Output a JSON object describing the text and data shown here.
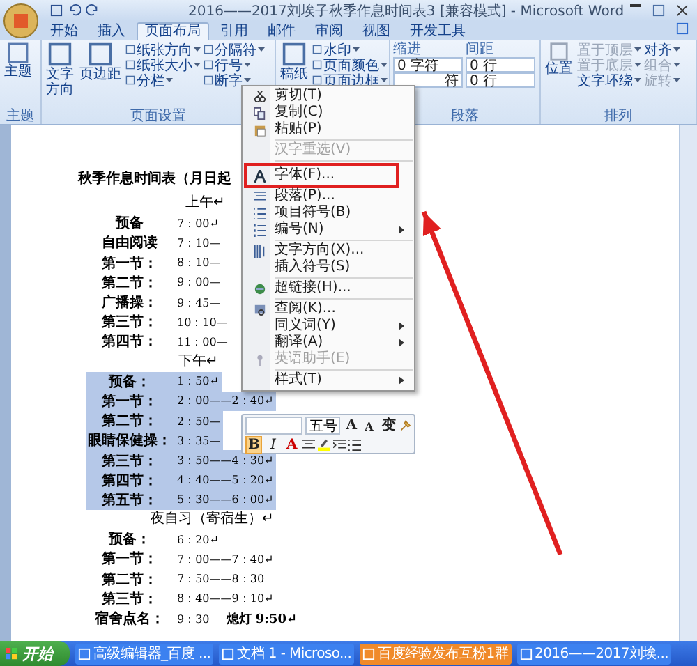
{
  "window": {
    "title": "2016——2017刘埃子秋季作息时间表3 [兼容模式] - Microsoft Word"
  },
  "tabs": [
    {
      "label": "开始",
      "selected": false
    },
    {
      "label": "插入",
      "selected": false
    },
    {
      "label": "页面布局",
      "selected": true
    },
    {
      "label": "引用",
      "selected": false
    },
    {
      "label": "邮件",
      "selected": false
    },
    {
      "label": "审阅",
      "selected": false
    },
    {
      "label": "视图",
      "selected": false
    },
    {
      "label": "开发工具",
      "selected": false
    }
  ],
  "ribbon": {
    "theme": {
      "label": "主题",
      "button": "主题"
    },
    "page_setup": {
      "label": "页面设置",
      "large": [
        "文字方向",
        "页边距"
      ],
      "small": [
        "纸张方向",
        "纸张大小",
        "分栏",
        "分隔符",
        "行号",
        "断字"
      ]
    },
    "background": {
      "large": "稿纸",
      "small": [
        "水印",
        "页面颜色",
        "页面边框"
      ]
    },
    "paragraph": {
      "label": "段落",
      "indent_label": "缩进",
      "indent": [
        "0 字符",
        "符"
      ],
      "spacing_label": "间距",
      "spacing": [
        "0 行",
        "0 行"
      ]
    },
    "arrange": {
      "label": "排列",
      "large": "位置",
      "small": [
        {
          "label": "置于顶层",
          "disabled": true
        },
        {
          "label": "置于底层",
          "disabled": true
        },
        {
          "label": "文字环绕",
          "disabled": false
        },
        {
          "label": "对齐",
          "disabled": false
        },
        {
          "label": "组合",
          "disabled": true
        },
        {
          "label": "旋转",
          "disabled": true
        }
      ]
    }
  },
  "document": {
    "title": "秋季作息时间表（月日起",
    "lines": [
      {
        "kind": "heading",
        "text": "上午↵"
      },
      {
        "kind": "entry",
        "label": "预备",
        "time": "7：00↵",
        "selected": false
      },
      {
        "kind": "entry",
        "label": "自由阅读",
        "time": "7：10—",
        "selected": false
      },
      {
        "kind": "entry",
        "label": "第一节：",
        "time": "8：10—",
        "selected": false
      },
      {
        "kind": "entry",
        "label": "第二节：",
        "time": "9：00—",
        "selected": false
      },
      {
        "kind": "entry",
        "label": "广播操：",
        "time": "9：45—",
        "selected": false
      },
      {
        "kind": "entry",
        "label": "第三节：",
        "time": "10：10—",
        "selected": false
      },
      {
        "kind": "entry",
        "label": "第四节：",
        "time": "11：00—",
        "selected": false
      },
      {
        "kind": "heading",
        "text": "下午↵"
      },
      {
        "kind": "entry",
        "label": "预备：",
        "time": "1：50↵",
        "selected": true
      },
      {
        "kind": "entry",
        "label": "第一节：",
        "time": "2：00——2：40↵",
        "selected": true
      },
      {
        "kind": "entry",
        "label": "第二节：",
        "time": "2：50—",
        "selected": true
      },
      {
        "kind": "entry",
        "label": "眼睛保健操：",
        "time": "3：35—",
        "selected": true
      },
      {
        "kind": "entry",
        "label": "第三节：",
        "time": "3：50——4：30↵",
        "selected": true
      },
      {
        "kind": "entry",
        "label": "第四节：",
        "time": "4：40——5：20↵",
        "selected": true
      },
      {
        "kind": "entry",
        "label": "第五节：",
        "time": "5：30——6：00↵",
        "selected": true
      },
      {
        "kind": "heading",
        "text": "夜自习（寄宿生）↵"
      },
      {
        "kind": "entry",
        "label": "预备：",
        "time": "6：20↵",
        "selected": false
      },
      {
        "kind": "entry",
        "label": "第一节：",
        "time": "7：00——7：40↵",
        "selected": false
      },
      {
        "kind": "entry",
        "label": "第二节：",
        "time": "7：50——8：30",
        "selected": false
      },
      {
        "kind": "entry",
        "label": "第三节：",
        "time": "8：40——9：10↵",
        "selected": false
      },
      {
        "kind": "entry",
        "label": "宿舍点名：",
        "time": "9：30",
        "note": "熄灯 9:50↵",
        "selected": false
      }
    ]
  },
  "context_menu": {
    "sections": [
      [
        {
          "label": "剪切(T)",
          "disabled": false,
          "submenu": false
        },
        {
          "label": "复制(C)",
          "disabled": false,
          "submenu": false
        },
        {
          "label": "粘贴(P)",
          "disabled": false,
          "submenu": false
        }
      ],
      [
        {
          "label": "汉字重选(V)",
          "disabled": true,
          "submenu": false
        }
      ],
      [
        {
          "label": "字体(F)...",
          "disabled": false,
          "submenu": false
        },
        {
          "label": "段落(P)...",
          "disabled": false,
          "submenu": false
        },
        {
          "label": "项目符号(B)",
          "disabled": false,
          "submenu": false
        },
        {
          "label": "编号(N)",
          "disabled": false,
          "submenu": true
        }
      ],
      [
        {
          "label": "文字方向(X)...",
          "disabled": false,
          "submenu": false
        },
        {
          "label": "插入符号(S)",
          "disabled": false,
          "submenu": false
        }
      ],
      [
        {
          "label": "超链接(H)...",
          "disabled": false,
          "submenu": false
        }
      ],
      [
        {
          "label": "查阅(K)...",
          "disabled": false,
          "submenu": false
        },
        {
          "label": "同义词(Y)",
          "disabled": false,
          "submenu": true
        },
        {
          "label": "翻译(A)",
          "disabled": false,
          "submenu": true
        },
        {
          "label": "英语助手(E)",
          "disabled": true,
          "submenu": false
        }
      ],
      [
        {
          "label": "样式(T)",
          "disabled": false,
          "submenu": true
        }
      ]
    ]
  },
  "mini_toolbar": {
    "font_size": "五号",
    "row1": [
      "A",
      "A",
      "变"
    ],
    "row2": [
      {
        "label": "B",
        "selected": true
      },
      {
        "label": "I",
        "selected": false
      },
      {
        "label": "A",
        "selected": false
      }
    ]
  },
  "taskbar": {
    "start": "开始",
    "tasks": [
      {
        "label": "高级编辑器_百度 ...",
        "selected": false
      },
      {
        "label": "文档 1 - Microso...",
        "selected": false
      },
      {
        "label": "百度经验发布互粉1群",
        "selected": true
      },
      {
        "label": "2016——2017刘埃...",
        "selected": false
      }
    ]
  }
}
